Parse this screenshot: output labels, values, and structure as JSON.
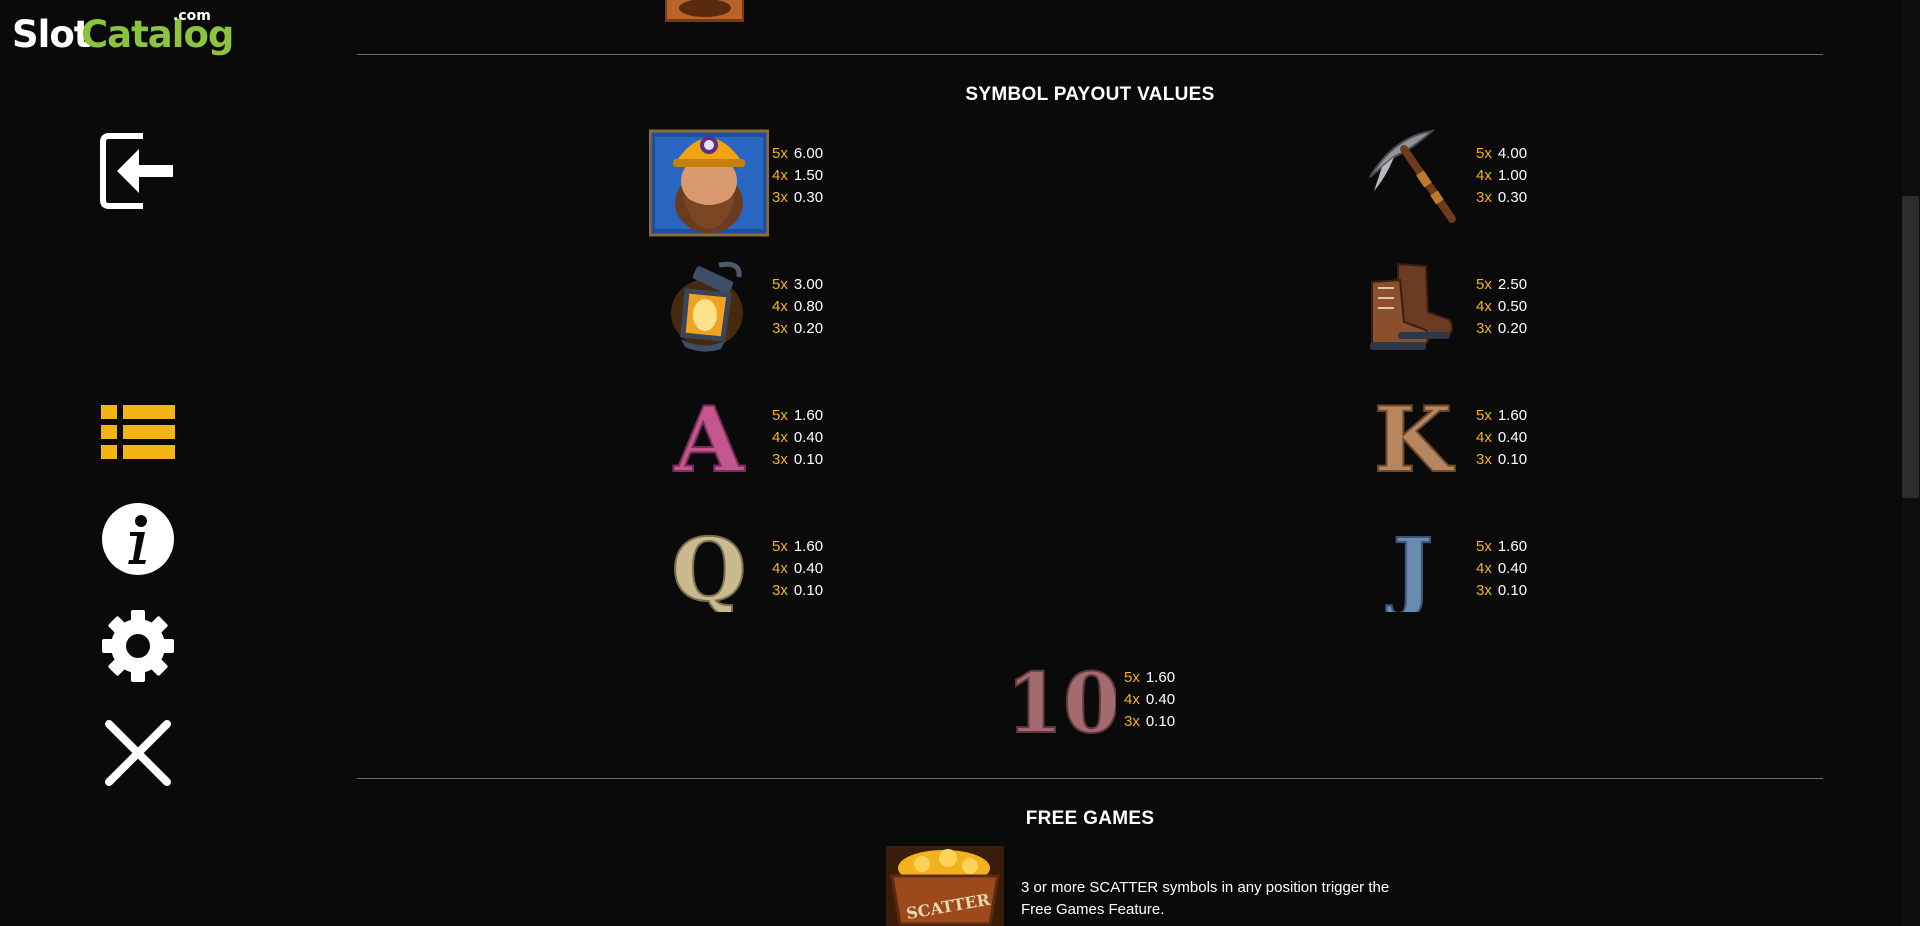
{
  "logo": {
    "slot": "Slot",
    "catalog": "Catalog",
    "dotcom": ".com"
  },
  "sidebar": {
    "icons": [
      "exit-icon",
      "paytable-list-icon",
      "info-icon",
      "settings-gear-icon",
      "close-icon"
    ],
    "accent": "#f3b516"
  },
  "payout_section": {
    "title": "SYMBOL PAYOUT VALUES",
    "symbols": [
      {
        "name": "miner",
        "rows": [
          {
            "m": "5x",
            "v": "6.00"
          },
          {
            "m": "4x",
            "v": "1.50"
          },
          {
            "m": "3x",
            "v": "0.30"
          }
        ]
      },
      {
        "name": "pickaxe",
        "rows": [
          {
            "m": "5x",
            "v": "4.00"
          },
          {
            "m": "4x",
            "v": "1.00"
          },
          {
            "m": "3x",
            "v": "0.30"
          }
        ]
      },
      {
        "name": "lantern",
        "rows": [
          {
            "m": "5x",
            "v": "3.00"
          },
          {
            "m": "4x",
            "v": "0.80"
          },
          {
            "m": "3x",
            "v": "0.20"
          }
        ]
      },
      {
        "name": "boots",
        "rows": [
          {
            "m": "5x",
            "v": "2.50"
          },
          {
            "m": "4x",
            "v": "0.50"
          },
          {
            "m": "3x",
            "v": "0.20"
          }
        ]
      },
      {
        "name": "A",
        "rows": [
          {
            "m": "5x",
            "v": "1.60"
          },
          {
            "m": "4x",
            "v": "0.40"
          },
          {
            "m": "3x",
            "v": "0.10"
          }
        ]
      },
      {
        "name": "K",
        "rows": [
          {
            "m": "5x",
            "v": "1.60"
          },
          {
            "m": "4x",
            "v": "0.40"
          },
          {
            "m": "3x",
            "v": "0.10"
          }
        ]
      },
      {
        "name": "Q",
        "rows": [
          {
            "m": "5x",
            "v": "1.60"
          },
          {
            "m": "4x",
            "v": "0.40"
          },
          {
            "m": "3x",
            "v": "0.10"
          }
        ]
      },
      {
        "name": "J",
        "rows": [
          {
            "m": "5x",
            "v": "1.60"
          },
          {
            "m": "4x",
            "v": "0.40"
          },
          {
            "m": "3x",
            "v": "0.10"
          }
        ]
      },
      {
        "name": "10",
        "rows": [
          {
            "m": "5x",
            "v": "1.60"
          },
          {
            "m": "4x",
            "v": "0.40"
          },
          {
            "m": "3x",
            "v": "0.10"
          }
        ]
      }
    ]
  },
  "free_games": {
    "title": "FREE GAMES",
    "scatter_label": "SCATTER",
    "text_line1": "3 or more SCATTER symbols in any position trigger the",
    "text_line2": "Free Games Feature."
  },
  "letters": {
    "A": "A",
    "K": "K",
    "Q": "Q",
    "J": "J",
    "ten": "10"
  }
}
